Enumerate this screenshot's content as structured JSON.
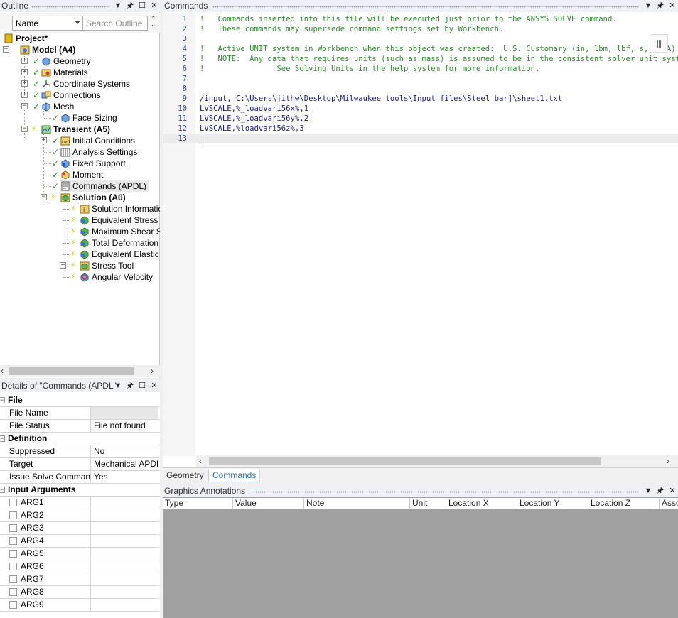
{
  "outline": {
    "title": "Outline",
    "name_filter": "Name",
    "search_placeholder": "Search Outline",
    "tree": [
      {
        "label": "Project*",
        "bold": true
      },
      {
        "label": "Model (A4)",
        "bold": true
      },
      {
        "label": "Geometry"
      },
      {
        "label": "Materials"
      },
      {
        "label": "Coordinate Systems"
      },
      {
        "label": "Connections"
      },
      {
        "label": "Mesh"
      },
      {
        "label": "Face Sizing"
      },
      {
        "label": "Transient (A5)",
        "bold": true
      },
      {
        "label": "Initial Conditions"
      },
      {
        "label": "Analysis Settings"
      },
      {
        "label": "Fixed Support"
      },
      {
        "label": "Moment"
      },
      {
        "label": "Commands (APDL)"
      },
      {
        "label": "Solution (A6)",
        "bold": true
      },
      {
        "label": "Solution Information"
      },
      {
        "label": "Equivalent Stress"
      },
      {
        "label": "Maximum Shear Stress"
      },
      {
        "label": "Total Deformation"
      },
      {
        "label": "Equivalent Elastic Strain"
      },
      {
        "label": "Stress Tool"
      },
      {
        "label": "Angular Velocity"
      }
    ]
  },
  "details": {
    "title": "Details of \"Commands (APDL\"",
    "sections": [
      {
        "name": "File",
        "rows": [
          {
            "key": "File Name",
            "value": ""
          },
          {
            "key": "File Status",
            "value": "File not found"
          }
        ]
      },
      {
        "name": "Definition",
        "rows": [
          {
            "key": "Suppressed",
            "value": "No"
          },
          {
            "key": "Target",
            "value": "Mechanical APDL"
          },
          {
            "key": "Issue Solve Command",
            "value": "Yes"
          }
        ]
      },
      {
        "name": "Input Arguments",
        "rows": [
          {
            "key": "ARG1",
            "value": ""
          },
          {
            "key": "ARG2",
            "value": ""
          },
          {
            "key": "ARG3",
            "value": ""
          },
          {
            "key": "ARG4",
            "value": ""
          },
          {
            "key": "ARG5",
            "value": ""
          },
          {
            "key": "ARG6",
            "value": ""
          },
          {
            "key": "ARG7",
            "value": ""
          },
          {
            "key": "ARG8",
            "value": ""
          },
          {
            "key": "ARG9",
            "value": ""
          }
        ]
      }
    ]
  },
  "commands": {
    "title": "Commands",
    "lines": [
      {
        "n": "1",
        "text": "!   Commands inserted into this file will be executed just prior to the ANSYS SOLVE command.",
        "type": "cmt"
      },
      {
        "n": "2",
        "text": "!   These commands may supersede command settings set by Workbench.",
        "type": "cmt"
      },
      {
        "n": "3",
        "text": "",
        "type": "cmt"
      },
      {
        "n": "4",
        "text": "!   Active UNIT system in Workbench when this object was created:  U.S. Customary (in, lbm, lbf, s, V, A)",
        "type": "cmt"
      },
      {
        "n": "5",
        "text": "!   NOTE:  Any data that requires units (such as mass) is assumed to be in the consistent solver unit system.",
        "type": "cmt"
      },
      {
        "n": "6",
        "text": "!                See Solving Units in the help system for more information.",
        "type": "cmt"
      },
      {
        "n": "7",
        "text": "",
        "type": "cmt"
      },
      {
        "n": "8",
        "text": "",
        "type": "cmt"
      },
      {
        "n": "9",
        "text": "/input, C:\\Users\\jithw\\Desktop\\Milwaukee tools\\Input files\\Steel bar]\\sheet1.txt",
        "type": "cmd"
      },
      {
        "n": "10",
        "text": "LVSCALE,%_loadvari56x%,1",
        "type": "cmd"
      },
      {
        "n": "11",
        "text": "LVSCALE,%_loadvari56y%,2",
        "type": "cmd"
      },
      {
        "n": "12",
        "text": "LVSCALE,%loadvari56z%,3",
        "type": "cmd"
      },
      {
        "n": "13",
        "text": "",
        "type": "cmd"
      }
    ]
  },
  "doc_tabs": [
    {
      "label": "Geometry",
      "active": false
    },
    {
      "label": "Commands",
      "active": true
    }
  ],
  "annotations": {
    "title": "Graphics Annotations",
    "columns": [
      "Type",
      "Value",
      "Note",
      "Unit",
      "Location X",
      "Location Y",
      "Location Z",
      "Associated"
    ]
  }
}
